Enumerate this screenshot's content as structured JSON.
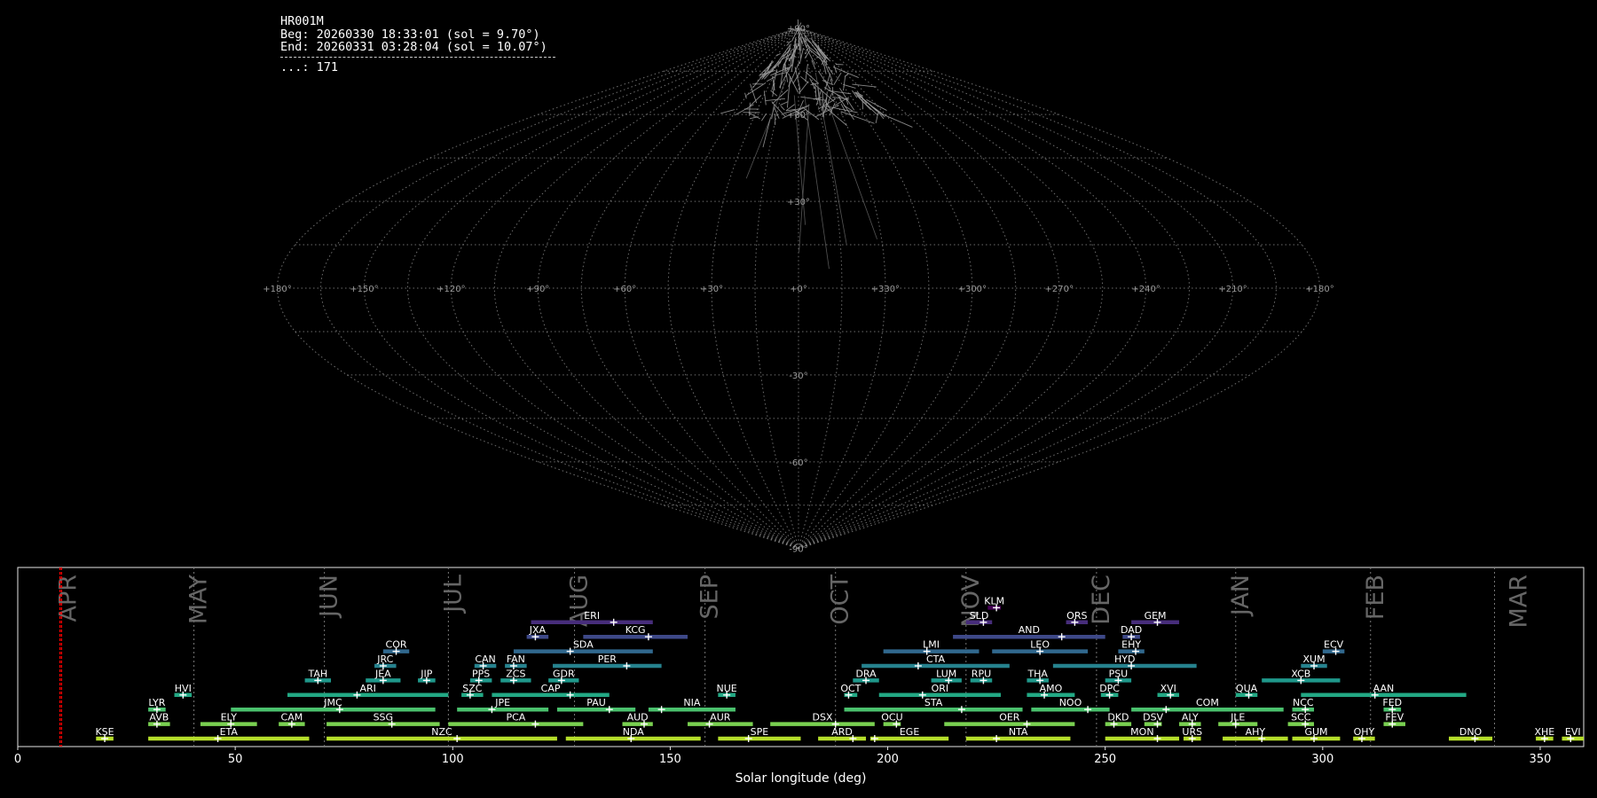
{
  "header": {
    "title": "HR001M",
    "begin": "Beg: 20260330 18:33:01 (sol = 9.70°)",
    "end": "End: 20260331 03:28:04 (sol = 10.07°)",
    "count": "...: 171"
  },
  "chart_data": [
    {
      "type": "sky-map",
      "projection": "sinusoidal",
      "lon_labels": [
        "+180°",
        "+150°",
        "+120°",
        "+90°",
        "+60°",
        "+30°",
        "+0°",
        "+330°",
        "+300°",
        "+270°",
        "+240°",
        "+210°",
        "+180°"
      ],
      "lat_labels": [
        "+90°",
        "+60°",
        "+30°",
        "-30°",
        "-60°",
        "-90°"
      ],
      "meteor_count": 171,
      "grid": true
    },
    {
      "type": "timeline",
      "xlabel": "Solar longitude (deg)",
      "xlim": [
        0,
        360
      ],
      "xticks": [
        0,
        50,
        100,
        150,
        200,
        250,
        300,
        350
      ],
      "current_sol": [
        9.7,
        10.07
      ],
      "months": [
        {
          "name": "APR",
          "start": 10.5,
          "end": 40.5
        },
        {
          "name": "MAY",
          "start": 40.5,
          "end": 70.5
        },
        {
          "name": "JUN",
          "start": 70.5,
          "end": 99
        },
        {
          "name": "JUL",
          "start": 99,
          "end": 128
        },
        {
          "name": "AUG",
          "start": 128,
          "end": 158
        },
        {
          "name": "SEP",
          "start": 158,
          "end": 188
        },
        {
          "name": "OCT",
          "start": 188,
          "end": 218
        },
        {
          "name": "NOV",
          "start": 218,
          "end": 248
        },
        {
          "name": "DEC",
          "start": 248,
          "end": 280
        },
        {
          "name": "JAN",
          "start": 280,
          "end": 311
        },
        {
          "name": "FEB",
          "start": 311,
          "end": 339.5
        },
        {
          "name": "MAR",
          "start": 339.5,
          "end": 360
        }
      ],
      "showers": [
        {
          "code": "KLM",
          "start": 223,
          "end": 226,
          "peak": 225,
          "row": 9
        },
        {
          "code": "ERI",
          "start": 118,
          "end": 146,
          "peak": 137,
          "row": 8
        },
        {
          "code": "SLD",
          "start": 218,
          "end": 224,
          "peak": 222,
          "row": 8
        },
        {
          "code": "ORS",
          "start": 241,
          "end": 246,
          "peak": 243,
          "row": 8
        },
        {
          "code": "GEM",
          "start": 256,
          "end": 267,
          "peak": 262,
          "row": 8
        },
        {
          "code": "JXA",
          "start": 117,
          "end": 122,
          "peak": 119,
          "row": 7
        },
        {
          "code": "KCG",
          "start": 130,
          "end": 154,
          "peak": 145,
          "row": 7
        },
        {
          "code": "AND",
          "start": 215,
          "end": 250,
          "peak": 240,
          "row": 7
        },
        {
          "code": "DAD",
          "start": 254,
          "end": 258,
          "peak": 256,
          "row": 7
        },
        {
          "code": "COR",
          "start": 84,
          "end": 90,
          "peak": 87,
          "row": 6
        },
        {
          "code": "SDA",
          "start": 114,
          "end": 146,
          "peak": 127,
          "row": 6
        },
        {
          "code": "LMI",
          "start": 199,
          "end": 221,
          "peak": 209,
          "row": 6
        },
        {
          "code": "LEO",
          "start": 224,
          "end": 246,
          "peak": 235,
          "row": 6
        },
        {
          "code": "EHY",
          "start": 253,
          "end": 259,
          "peak": 257,
          "row": 6
        },
        {
          "code": "ECV",
          "start": 300,
          "end": 305,
          "peak": 303,
          "row": 6
        },
        {
          "code": "JRC",
          "start": 82,
          "end": 87,
          "peak": 84,
          "row": 5
        },
        {
          "code": "CAN",
          "start": 105,
          "end": 110,
          "peak": 107,
          "row": 5
        },
        {
          "code": "FAN",
          "start": 112,
          "end": 117,
          "peak": 114,
          "row": 5
        },
        {
          "code": "PER",
          "start": 123,
          "end": 148,
          "peak": 140,
          "row": 5
        },
        {
          "code": "CTA",
          "start": 194,
          "end": 228,
          "peak": 207,
          "row": 5
        },
        {
          "code": "HYD",
          "start": 238,
          "end": 271,
          "peak": 256,
          "row": 5
        },
        {
          "code": "XUM",
          "start": 295,
          "end": 301,
          "peak": 298,
          "row": 5
        },
        {
          "code": "TAH",
          "start": 66,
          "end": 72,
          "peak": 69,
          "row": 4
        },
        {
          "code": "JEA",
          "start": 80,
          "end": 88,
          "peak": 84,
          "row": 4
        },
        {
          "code": "JIP",
          "start": 92,
          "end": 96,
          "peak": 94,
          "row": 4
        },
        {
          "code": "PPS",
          "start": 104,
          "end": 109,
          "peak": 106,
          "row": 4
        },
        {
          "code": "ZCS",
          "start": 111,
          "end": 118,
          "peak": 114,
          "row": 4
        },
        {
          "code": "GDR",
          "start": 122,
          "end": 129,
          "peak": 125,
          "row": 4
        },
        {
          "code": "DRA",
          "start": 192,
          "end": 198,
          "peak": 195,
          "row": 4
        },
        {
          "code": "LUM",
          "start": 210,
          "end": 217,
          "peak": 214,
          "row": 4
        },
        {
          "code": "RPU",
          "start": 219,
          "end": 224,
          "peak": 222,
          "row": 4
        },
        {
          "code": "THA",
          "start": 232,
          "end": 237,
          "peak": 235,
          "row": 4
        },
        {
          "code": "PSU",
          "start": 250,
          "end": 256,
          "peak": 253,
          "row": 4
        },
        {
          "code": "XCB",
          "start": 286,
          "end": 304,
          "peak": 295,
          "row": 4
        },
        {
          "code": "HVI",
          "start": 36,
          "end": 40,
          "peak": 38,
          "row": 3
        },
        {
          "code": "ARI",
          "start": 62,
          "end": 99,
          "peak": 78,
          "row": 3
        },
        {
          "code": "SZC",
          "start": 102,
          "end": 107,
          "peak": 104,
          "row": 3
        },
        {
          "code": "CAP",
          "start": 109,
          "end": 136,
          "peak": 127,
          "row": 3
        },
        {
          "code": "NUE",
          "start": 161,
          "end": 165,
          "peak": 163,
          "row": 3
        },
        {
          "code": "OCT",
          "start": 190,
          "end": 193,
          "peak": 191,
          "row": 3
        },
        {
          "code": "ORI",
          "start": 198,
          "end": 226,
          "peak": 208,
          "row": 3
        },
        {
          "code": "AMO",
          "start": 232,
          "end": 243,
          "peak": 236,
          "row": 3
        },
        {
          "code": "DPC",
          "start": 249,
          "end": 253,
          "peak": 251,
          "row": 3
        },
        {
          "code": "XVI",
          "start": 262,
          "end": 267,
          "peak": 265,
          "row": 3
        },
        {
          "code": "QUA",
          "start": 280,
          "end": 285,
          "peak": 283,
          "row": 3
        },
        {
          "code": "AAN",
          "start": 295,
          "end": 333,
          "peak": 312,
          "row": 3
        },
        {
          "code": "LYR",
          "start": 30,
          "end": 34,
          "peak": 32,
          "row": 2
        },
        {
          "code": "JMC",
          "start": 49,
          "end": 96,
          "peak": 74,
          "row": 2
        },
        {
          "code": "JPE",
          "start": 101,
          "end": 122,
          "peak": 109,
          "row": 2
        },
        {
          "code": "PAU",
          "start": 124,
          "end": 142,
          "peak": 136,
          "row": 2
        },
        {
          "code": "NIA",
          "start": 145,
          "end": 165,
          "peak": 148,
          "row": 2
        },
        {
          "code": "STA",
          "start": 190,
          "end": 231,
          "peak": 217,
          "row": 2
        },
        {
          "code": "NOO",
          "start": 233,
          "end": 251,
          "peak": 246,
          "row": 2
        },
        {
          "code": "COM",
          "start": 256,
          "end": 291,
          "peak": 264,
          "row": 2
        },
        {
          "code": "NCC",
          "start": 293,
          "end": 298,
          "peak": 296,
          "row": 2
        },
        {
          "code": "FED",
          "start": 314,
          "end": 318,
          "peak": 316,
          "row": 2
        },
        {
          "code": "AVB",
          "start": 30,
          "end": 35,
          "peak": 32,
          "row": 1
        },
        {
          "code": "ELY",
          "start": 42,
          "end": 55,
          "peak": 49,
          "row": 1
        },
        {
          "code": "CAM",
          "start": 60,
          "end": 66,
          "peak": 63,
          "row": 1
        },
        {
          "code": "SSG",
          "start": 71,
          "end": 97,
          "peak": 86,
          "row": 1
        },
        {
          "code": "PCA",
          "start": 99,
          "end": 130,
          "peak": 119,
          "row": 1
        },
        {
          "code": "AUD",
          "start": 139,
          "end": 146,
          "peak": 144,
          "row": 1
        },
        {
          "code": "AUR",
          "start": 154,
          "end": 169,
          "peak": 159,
          "row": 1
        },
        {
          "code": "DSX",
          "start": 173,
          "end": 197,
          "peak": 188,
          "row": 1
        },
        {
          "code": "OCU",
          "start": 199,
          "end": 203,
          "peak": 202,
          "row": 1
        },
        {
          "code": "OER",
          "start": 213,
          "end": 243,
          "peak": 232,
          "row": 1
        },
        {
          "code": "DKD",
          "start": 250,
          "end": 256,
          "peak": 252,
          "row": 1
        },
        {
          "code": "DSV",
          "start": 259,
          "end": 263,
          "peak": 262,
          "row": 1
        },
        {
          "code": "ALY",
          "start": 267,
          "end": 272,
          "peak": 270,
          "row": 1
        },
        {
          "code": "JLE",
          "start": 276,
          "end": 285,
          "peak": 280,
          "row": 1
        },
        {
          "code": "SCC",
          "start": 292,
          "end": 298,
          "peak": 296,
          "row": 1
        },
        {
          "code": "FEV",
          "start": 314,
          "end": 319,
          "peak": 316,
          "row": 1
        },
        {
          "code": "KSE",
          "start": 18,
          "end": 22,
          "peak": 20,
          "row": 0
        },
        {
          "code": "ETA",
          "start": 30,
          "end": 67,
          "peak": 46,
          "row": 0
        },
        {
          "code": "NZC",
          "start": 71,
          "end": 124,
          "peak": 101,
          "row": 0
        },
        {
          "code": "NDA",
          "start": 126,
          "end": 157,
          "peak": 141,
          "row": 0
        },
        {
          "code": "SPE",
          "start": 161,
          "end": 180,
          "peak": 168,
          "row": 0
        },
        {
          "code": "ARD",
          "start": 184,
          "end": 195,
          "peak": 192,
          "row": 0
        },
        {
          "code": "EGE",
          "start": 196,
          "end": 214,
          "peak": 197,
          "row": 0
        },
        {
          "code": "NTA",
          "start": 218,
          "end": 242,
          "peak": 225,
          "row": 0
        },
        {
          "code": "MON",
          "start": 250,
          "end": 267,
          "peak": 262,
          "row": 0
        },
        {
          "code": "URS",
          "start": 268,
          "end": 272,
          "peak": 270,
          "row": 0
        },
        {
          "code": "AHY",
          "start": 277,
          "end": 292,
          "peak": 286,
          "row": 0
        },
        {
          "code": "GUM",
          "start": 293,
          "end": 304,
          "peak": 298,
          "row": 0
        },
        {
          "code": "OHY",
          "start": 307,
          "end": 312,
          "peak": 309,
          "row": 0
        },
        {
          "code": "DNO",
          "start": 329,
          "end": 339,
          "peak": 335,
          "row": 0
        },
        {
          "code": "XHE",
          "start": 349,
          "end": 353,
          "peak": 351,
          "row": 0
        },
        {
          "code": "EVI",
          "start": 355,
          "end": 360,
          "peak": 357,
          "row": 0
        }
      ]
    }
  ]
}
